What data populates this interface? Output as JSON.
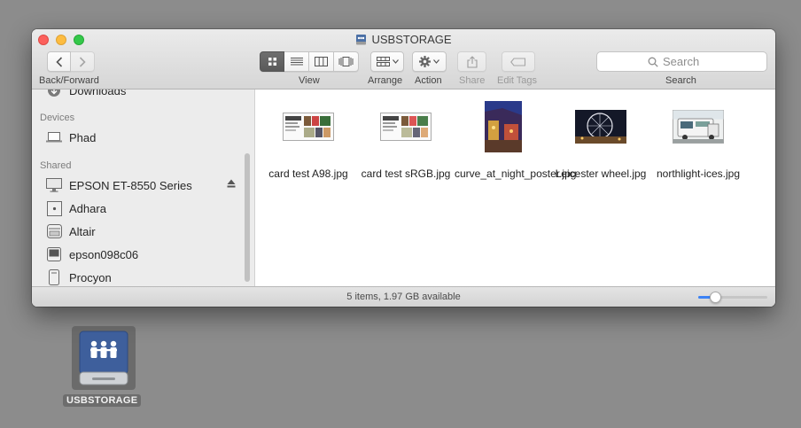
{
  "window": {
    "title": "USBSTORAGE",
    "title_icon": "usb-drive-icon"
  },
  "toolbar": {
    "back_forward_label": "Back/Forward",
    "view_label": "View",
    "arrange_label": "Arrange",
    "action_label": "Action",
    "share_label": "Share",
    "edit_tags_label": "Edit Tags",
    "search_label": "Search",
    "search_placeholder": "Search"
  },
  "sidebar": {
    "partial_item": "Downloads",
    "devices_header": "Devices",
    "devices": [
      {
        "label": "Phad",
        "icon": "laptop-icon"
      }
    ],
    "shared_header": "Shared",
    "shared": [
      {
        "label": "EPSON ET-8550 Series",
        "icon": "display-icon"
      },
      {
        "label": "Adhara",
        "icon": "server-icon"
      },
      {
        "label": "Altair",
        "icon": "nas-icon"
      },
      {
        "label": "epson098c06",
        "icon": "monitor-icon"
      },
      {
        "label": "Procyon",
        "icon": "tower-icon"
      }
    ]
  },
  "files": [
    {
      "name": "card test A98.jpg",
      "thumb": "card-thumb"
    },
    {
      "name": "card test sRGB.jpg",
      "thumb": "card-thumb"
    },
    {
      "name": "curve_at_night_poster.jpg",
      "thumb": "night-thumb"
    },
    {
      "name": "Leicester wheel.jpg",
      "thumb": "wheel-thumb"
    },
    {
      "name": "northlight-ices.jpg",
      "thumb": "van-thumb"
    }
  ],
  "status": {
    "text": "5 items, 1.97 GB available",
    "icon_size_fraction": 0.25
  },
  "desktop": {
    "drive_label": "USBSTORAGE"
  },
  "colors": {
    "accent": "#3b82f6",
    "close": "#fc605c",
    "minimize": "#fdbc40",
    "maximize": "#34c84a"
  }
}
